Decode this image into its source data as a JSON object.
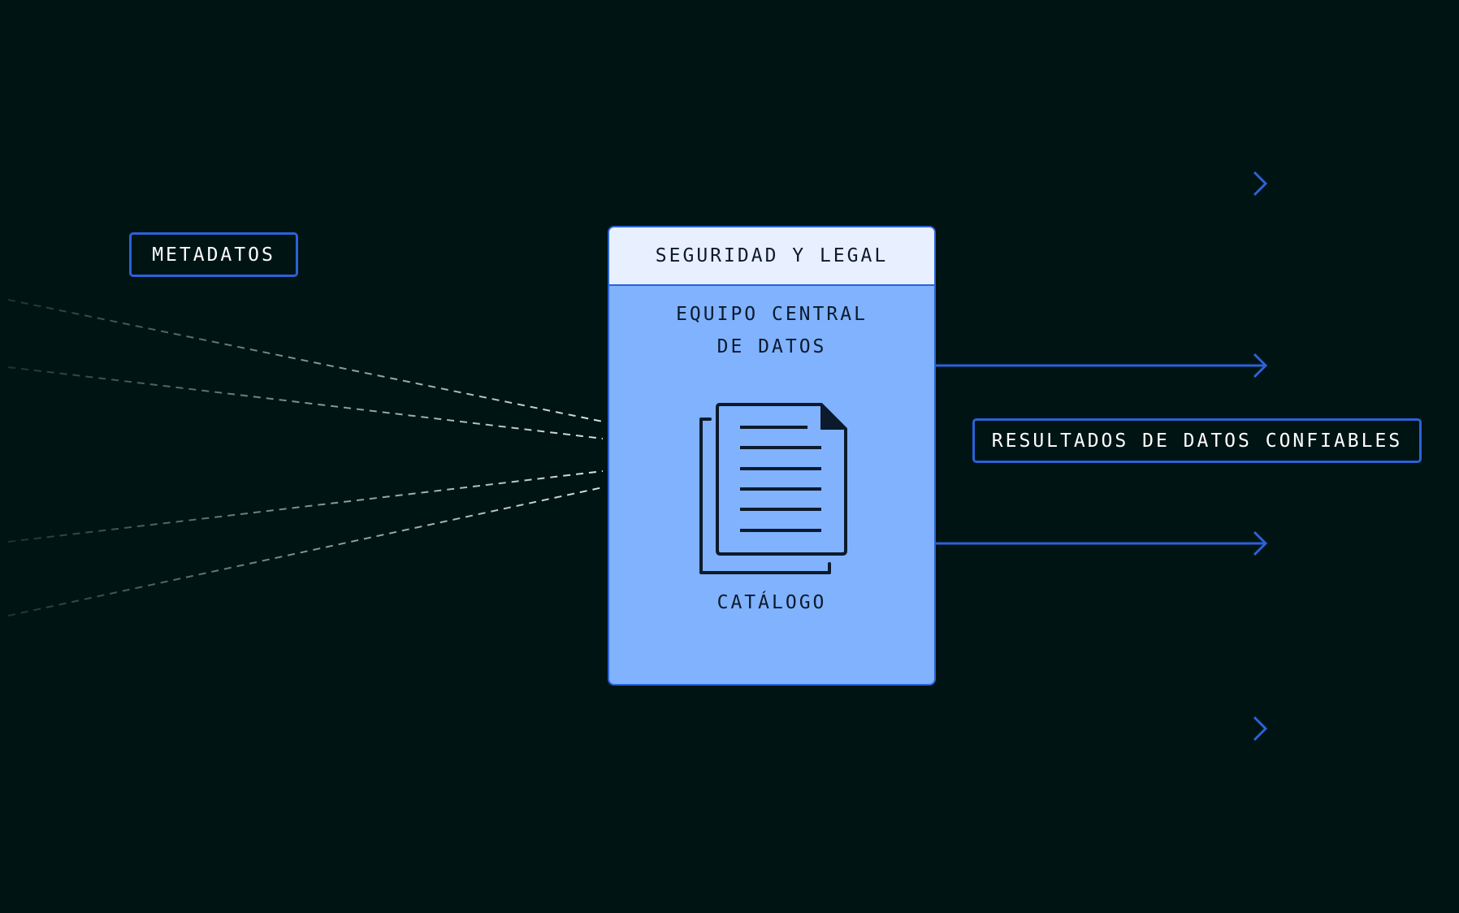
{
  "labels": {
    "metadata": "METADATOS",
    "outputs": "RESULTADOS DE DATOS CONFIABLES"
  },
  "catalog_box": {
    "header": "SEGURIDAD Y LEGAL",
    "team_line_1": "EQUIPO CENTRAL",
    "team_line_2": "DE DATOS",
    "label": "CATÁLOGO",
    "icon": "document-stack-icon"
  },
  "colors": {
    "background": "#011414",
    "accent_blue": "#2b62d9",
    "box_fill": "#80b2fe",
    "header_fill": "#e8efff",
    "dashed_lines": "#c9d4d4"
  }
}
